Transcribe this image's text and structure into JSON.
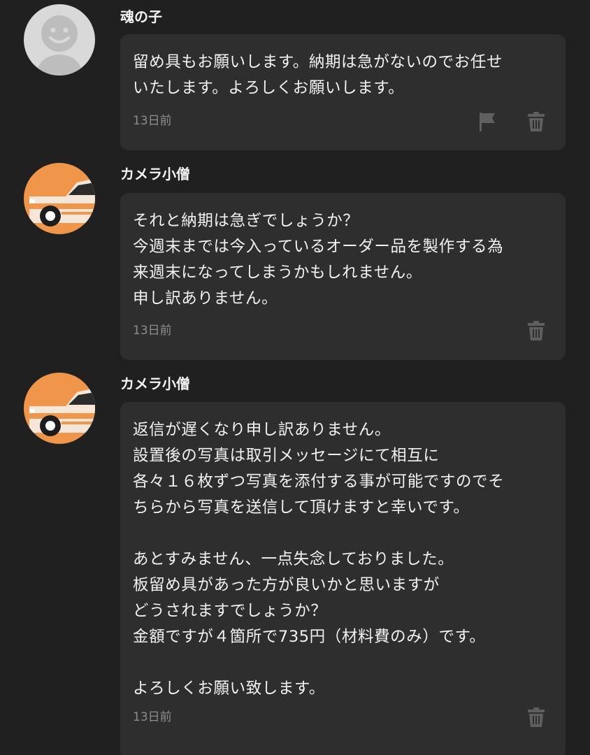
{
  "messages": [
    {
      "sender": "魂の子",
      "avatar": "default-person-icon",
      "body": "留め具もお願いします。納期は急がないのでお任せ\nいたします。よろしくお願いします。",
      "time": "13日前",
      "actions": [
        "flag-icon",
        "trash-icon"
      ]
    },
    {
      "sender": "カメラ小僧",
      "avatar": "car-icon",
      "body": "それと納期は急ぎでしょうか？\n今週末までは今入っているオーダー品を製作する為\n来週末になってしまうかもしれません。\n申し訳ありません。",
      "time": "13日前",
      "actions": [
        "trash-icon"
      ]
    },
    {
      "sender": "カメラ小僧",
      "avatar": "car-icon",
      "body": "返信が遅くなり申し訳ありません。\n設置後の写真は取引メッセージにて相互に\n各々１６枚ずつ写真を添付する事が可能ですのでそ\nちらから写真を送信して頂けますと幸いです。\n\nあとすみません、一点失念しておりました。\n板留め具があった方が良いかと思いますが\nどうされますでしょうか？\n金額ですが４箇所で735円（材料費のみ）です。\n\nよろしくお願い致します。",
      "time": "13日前",
      "actions": [
        "trash-icon"
      ]
    }
  ],
  "colors": {
    "background": "#202020",
    "bubble": "#2e2e2e",
    "avatar_orange": "#f0964a",
    "icon_gray": "#5f5f5f"
  }
}
